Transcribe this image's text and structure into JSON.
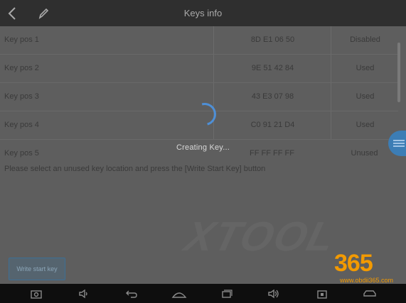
{
  "header": {
    "back_icon": "chevron-left-icon",
    "edit_icon": "pencil-icon",
    "title": "Keys info"
  },
  "table": {
    "rows": [
      {
        "position": "Key pos 1",
        "id": "8D E1 06 50",
        "status": "Disabled"
      },
      {
        "position": "Key pos 2",
        "id": "9E 51 42 84",
        "status": "Used"
      },
      {
        "position": "Key pos 3",
        "id": "43 E3 07 98",
        "status": "Used"
      },
      {
        "position": "Key pos 4",
        "id": "C0 91 21 D4",
        "status": "Used"
      },
      {
        "position": "Key pos 5",
        "id": "FF FF FF FF",
        "status": "Unused"
      }
    ]
  },
  "instructions": "Please select an unused key location and press the [Write Start Key] button",
  "loading": {
    "text": "Creating Key..."
  },
  "actions": {
    "write_start_key": "Write start key"
  },
  "watermark": {
    "text": "XTOOL"
  },
  "logo": {
    "digits": "365",
    "url": "www.obdii365.com"
  },
  "navbar": {
    "icons": [
      "screenshot-icon",
      "volume-down-icon",
      "back-arrow-icon",
      "home-icon",
      "recent-apps-icon",
      "volume-up-icon",
      "vci-icon",
      "car-icon"
    ]
  },
  "colors": {
    "header_bg": "#2f2f2f",
    "overlay_bg": "#5e5e5e",
    "accent": "#4e8fd6",
    "logo": "#f39a00"
  }
}
